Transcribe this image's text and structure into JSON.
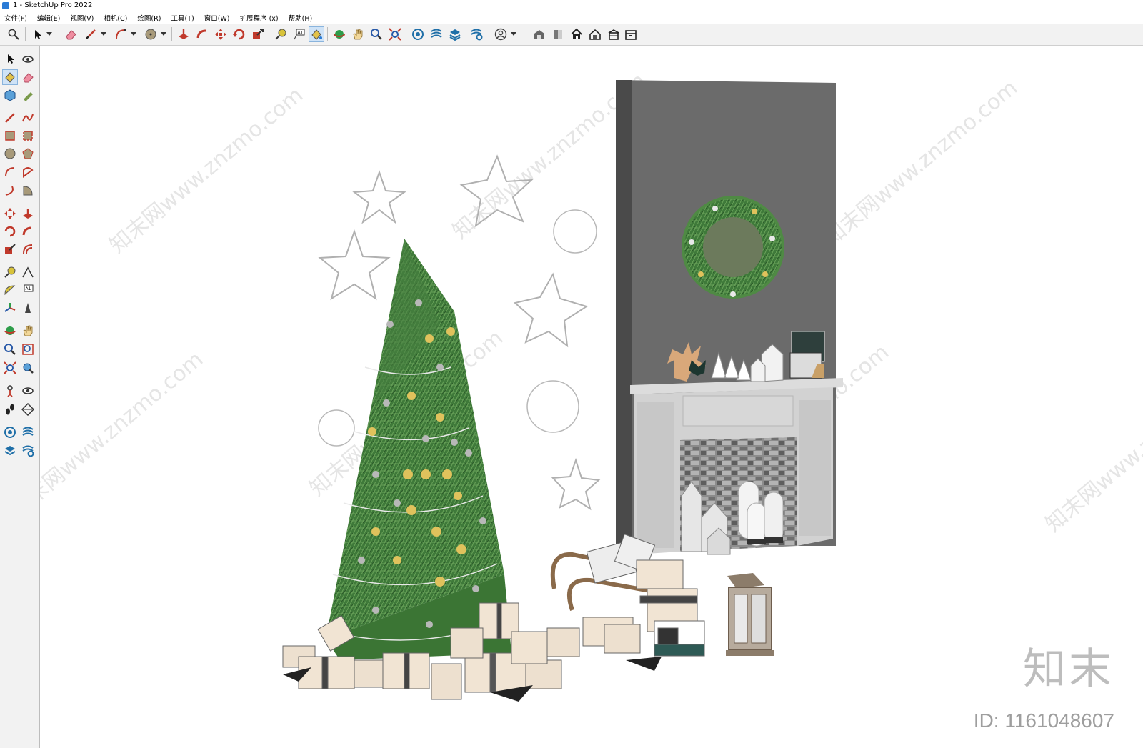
{
  "window": {
    "title": "1 - SketchUp Pro 2022"
  },
  "menu": [
    "文件(F)",
    "编辑(E)",
    "视图(V)",
    "相机(C)",
    "绘图(R)",
    "工具(T)",
    "窗口(W)",
    "扩展程序 (x)",
    "帮助(H)"
  ],
  "toolbar_icons": [
    "zoom-icon",
    "select-icon",
    "eraser-icon",
    "pencil-line-icon",
    "arc-icon",
    "circle-icon",
    "push-pull-icon",
    "follow-me-icon",
    "move-icon",
    "rotate-icon",
    "scale-icon",
    "tape-measure-icon",
    "text-label-icon",
    "paint-bucket-icon",
    "orbit-icon",
    "pan-icon",
    "zoom-window-icon",
    "zoom-extents-icon",
    "components-icon",
    "sandbox-icon",
    "layers-icon",
    "styles-icon",
    "user-account-icon",
    "warehouse-icon",
    "extension-icon",
    "home-icon",
    "house-icon",
    "storage-icon"
  ],
  "left_tools": [
    "select-icon",
    "orbit-icon",
    "paint-bucket-icon",
    "eraser-icon",
    "component-icon",
    "tape-icon",
    "line-icon",
    "freehand-icon",
    "rectangle-icon",
    "rotated-rectangle-icon",
    "circle-icon",
    "polygon-icon",
    "arc-icon",
    "pie-icon",
    "two-point-arc-icon",
    "three-point-arc-icon",
    "move-icon",
    "push-pull-icon",
    "rotate-icon",
    "follow-me-icon",
    "scale-icon",
    "offset-icon",
    "tape-measure-icon",
    "dimension-icon",
    "protractor-icon",
    "text-icon",
    "axes-icon",
    "3d-text-icon",
    "orbit-view-icon",
    "pan-view-icon",
    "zoom-view-icon",
    "zoom-window-view-icon",
    "zoom-extents-view-icon",
    "previous-view-icon",
    "position-camera-icon",
    "look-around-icon",
    "walk-icon",
    "section-plane-icon",
    "warehouse-icon",
    "sandbox-icon",
    "layers-icon",
    "scenes-icon"
  ],
  "watermarks": [
    "知末网www.znzmo.com"
  ],
  "brand": {
    "logo": "知末",
    "id": "ID: 1161048607"
  }
}
